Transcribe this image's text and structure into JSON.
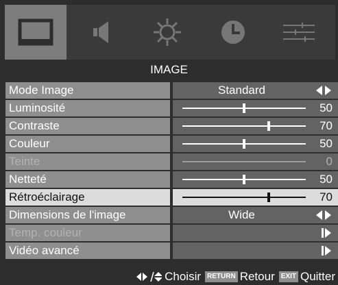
{
  "menu_title": "IMAGE",
  "tabs": [
    {
      "icon": "picture-icon",
      "active": true
    },
    {
      "icon": "speaker-icon",
      "active": false
    },
    {
      "icon": "sun-gear-icon",
      "active": false
    },
    {
      "icon": "clock-icon",
      "active": false
    },
    {
      "icon": "equalizer-icon",
      "active": false
    }
  ],
  "rows": [
    {
      "label": "Mode Image",
      "value": "Standard",
      "kind": "select",
      "disabled": false,
      "selected": false
    },
    {
      "label": "Luminosité",
      "value": "50",
      "kind": "slider",
      "level": 0.5,
      "disabled": false,
      "selected": false
    },
    {
      "label": "Contraste",
      "value": "70",
      "kind": "slider",
      "level": 0.7,
      "disabled": false,
      "selected": false
    },
    {
      "label": "Couleur",
      "value": "50",
      "kind": "slider",
      "level": 0.5,
      "disabled": false,
      "selected": false
    },
    {
      "label": "Teinte",
      "value": "0",
      "kind": "slider",
      "level": 0.5,
      "disabled": true,
      "selected": false
    },
    {
      "label": "Netteté",
      "value": "50",
      "kind": "slider",
      "level": 0.5,
      "disabled": false,
      "selected": false
    },
    {
      "label": "Rétroéclairage",
      "value": "70",
      "kind": "slider",
      "level": 0.7,
      "disabled": false,
      "selected": true
    },
    {
      "label": "Dimensions de l'image",
      "value": "Wide",
      "kind": "select",
      "disabled": false,
      "selected": false
    },
    {
      "label": "Temp. couleur",
      "value": "",
      "kind": "submenu",
      "disabled": true,
      "selected": false
    },
    {
      "label": "Vidéo avancé",
      "value": "",
      "kind": "submenu",
      "disabled": false,
      "selected": false
    }
  ],
  "footer": {
    "choose_label": "Choisir",
    "return_key": "RETURN",
    "return_label": "Retour",
    "exit_key": "EXIT",
    "exit_label": "Quitter"
  },
  "colors": {
    "background": "#2d2d2d",
    "label_bg": "#8f8f8f",
    "value_bg": "#636363",
    "selected_bg": "#dcdcdc",
    "active_tab": "#7d7d7d"
  }
}
